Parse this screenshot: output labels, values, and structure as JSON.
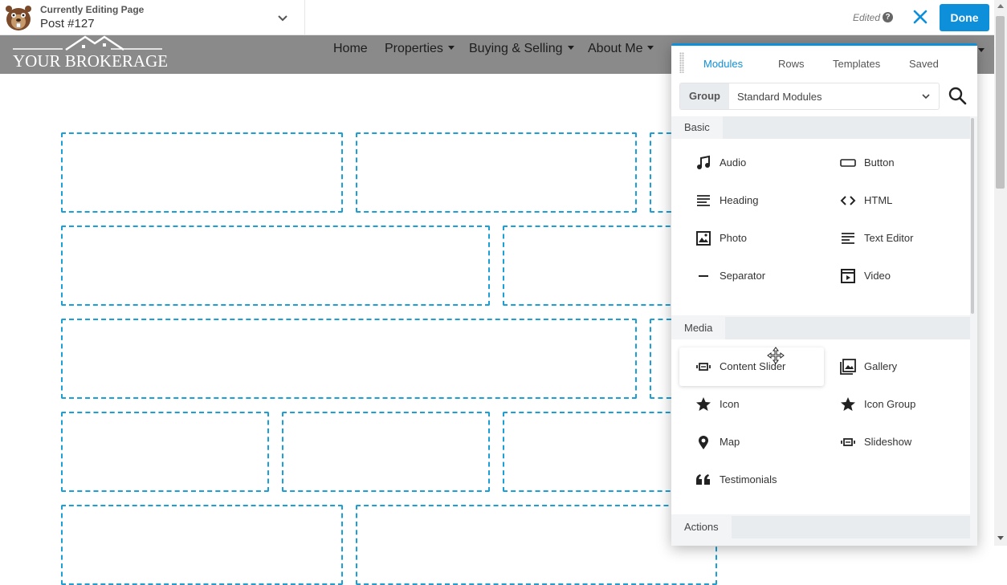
{
  "topbar": {
    "editing_label": "Currently Editing Page",
    "editing_title": "Post #127",
    "edited_status": "Edited",
    "help_glyph": "?",
    "done_label": "Done"
  },
  "site": {
    "logo_text": "YOUR BROKERAGE",
    "nav": [
      {
        "label": "Home"
      },
      {
        "label": "Properties"
      },
      {
        "label": "Buying & Selling"
      },
      {
        "label": "About Me"
      }
    ]
  },
  "panel": {
    "tabs": [
      "Modules",
      "Rows",
      "Templates",
      "Saved"
    ],
    "active_tab": "Modules",
    "group_label": "Group",
    "group_value": "Standard Modules",
    "sections": [
      {
        "title": "Basic",
        "modules": [
          "Audio",
          "Button",
          "Heading",
          "HTML",
          "Photo",
          "Text Editor",
          "Separator",
          "Video"
        ]
      },
      {
        "title": "Media",
        "modules": [
          "Content Slider",
          "Gallery",
          "Icon",
          "Icon Group",
          "Map",
          "Slideshow",
          "Testimonials"
        ]
      },
      {
        "title": "Actions",
        "modules": []
      }
    ]
  },
  "colors": {
    "accent": "#0e8fd9",
    "header_bg": "#8a8a8a",
    "dropzone_border": "#1a9fd6"
  },
  "icons": {
    "Audio": "music-note-icon",
    "Button": "button-icon",
    "Heading": "heading-icon",
    "HTML": "code-icon",
    "Photo": "photo-icon",
    "Text Editor": "text-editor-icon",
    "Separator": "separator-icon",
    "Video": "video-icon",
    "Content Slider": "slider-icon",
    "Gallery": "gallery-icon",
    "Icon": "star-icon",
    "Icon Group": "star-icon",
    "Map": "map-pin-icon",
    "Slideshow": "slideshow-icon",
    "Testimonials": "quote-icon"
  }
}
